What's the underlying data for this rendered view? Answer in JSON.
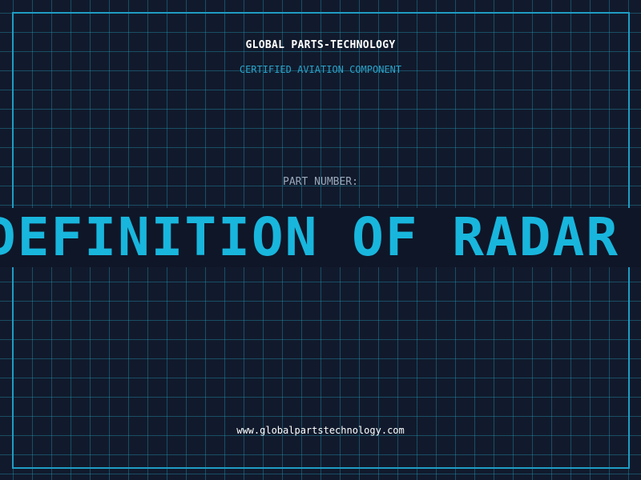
{
  "header": {
    "company": "GLOBAL PARTS-TECHNOLOGY",
    "subtitle": "CERTIFIED AVIATION COMPONENT"
  },
  "part": {
    "label": "PART NUMBER:",
    "value": "DEFINITION OF RADAR"
  },
  "footer": {
    "url": "www.globalpartstechnology.com"
  },
  "colors": {
    "background": "#111a2c",
    "grid": "#2496b2",
    "frame": "#1f9cc4",
    "accent": "#18b6dd",
    "subtitle": "#2aa3c9",
    "label": "#9aa8bb",
    "text": "#ffffff"
  }
}
